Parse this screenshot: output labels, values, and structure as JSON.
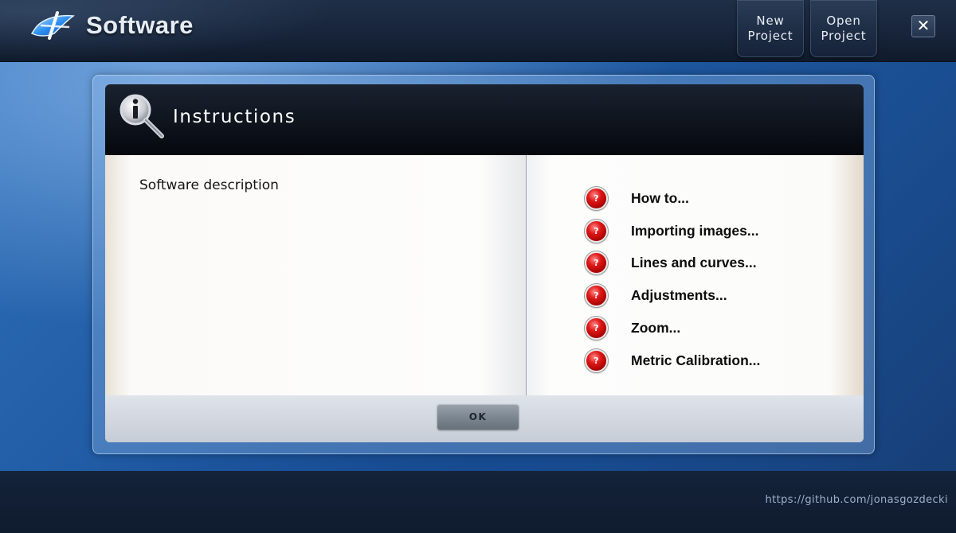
{
  "header": {
    "app_title": "Software",
    "new_project_label": [
      "New",
      "Project"
    ],
    "open_project_label": [
      "Open",
      "Project"
    ],
    "close_glyph": "✕"
  },
  "dialog": {
    "title": "Instructions",
    "description": "Software description",
    "help_items": [
      {
        "icon": "?",
        "label": "How to..."
      },
      {
        "icon": "?",
        "label": "Importing images..."
      },
      {
        "icon": "?",
        "label": "Lines and curves..."
      },
      {
        "icon": "?",
        "label": "Adjustments..."
      },
      {
        "icon": "?",
        "label": "Zoom..."
      },
      {
        "icon": "?",
        "label": "Metric Calibration..."
      }
    ],
    "ok_label": "OK"
  },
  "footer": {
    "credit": "https://github.com/jonasgozdecki"
  },
  "icons": {
    "app_logo": "app-logo-icon",
    "dialog_icon": "info-magnifier-icon",
    "help_icon": "question-mark-icon"
  },
  "colors": {
    "accent_blue": "#1f5aa3",
    "help_red": "#c80000",
    "header_dark": "#05080d"
  }
}
